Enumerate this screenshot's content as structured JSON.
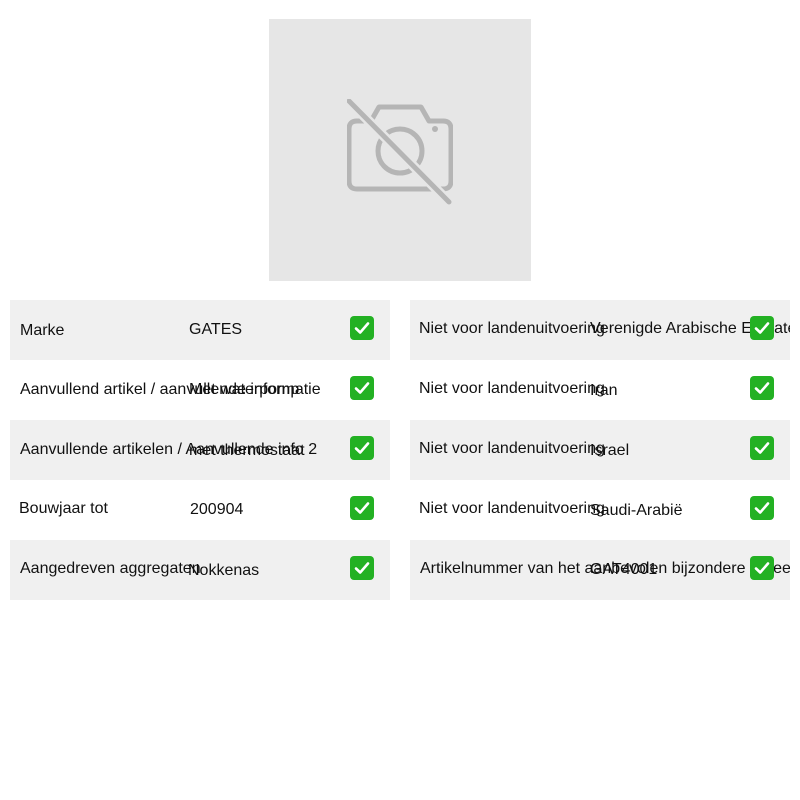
{
  "image": {
    "icon": "no-photo-icon"
  },
  "left_table": {
    "rows": [
      {
        "label": "Marke",
        "value": "GATES",
        "status": "check-icon"
      },
      {
        "label": "Aanvullend artikel / aanvullende informatie",
        "value": "Met waterpomp",
        "status": "check-icon"
      },
      {
        "label": "Aanvullende artikelen / Aanvullende info 2",
        "value": "met thermostaat",
        "status": "check-icon"
      },
      {
        "label": "Bouwjaar tot",
        "value": "200904",
        "status": "check-icon"
      },
      {
        "label": "Aangedreven aggregaten",
        "value": "Nokkenas",
        "status": "check-icon"
      }
    ]
  },
  "right_table": {
    "rows": [
      {
        "label": "Niet voor landenuitvoering",
        "value": "Verenigde Arabische Emiraten",
        "status": "check-icon"
      },
      {
        "label": "Niet voor landenuitvoering",
        "value": "Iran",
        "status": "check-icon"
      },
      {
        "label": "Niet voor landenuitvoering",
        "value": "Israel",
        "status": "check-icon"
      },
      {
        "label": "Niet voor landenuitvoering",
        "value": "Saudi-Arabië",
        "status": "check-icon"
      },
      {
        "label": "Artikelnummer van het aanbevolen bijzondere gereedschap",
        "value": "GAT4001",
        "status": "check-icon"
      }
    ]
  },
  "colors": {
    "row_shade": "#f0f0f0",
    "check_green": "#23b123",
    "placeholder_bg": "#e6e6e6",
    "placeholder_icon": "#b5b5b5"
  }
}
